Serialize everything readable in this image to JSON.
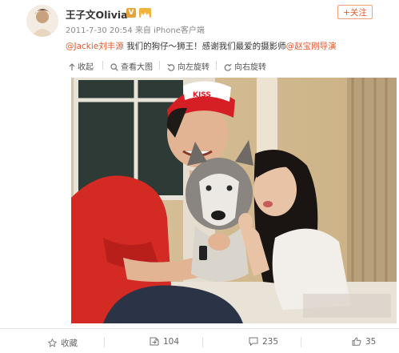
{
  "post": {
    "author": "王子文Olivia",
    "verified_badge": "V",
    "time": "2011-7-30 20:54",
    "source": "来自 iPhone客户端",
    "follow_label": "+关注",
    "caption": {
      "mention1": "@Jackie刘丰源",
      "text1": " 我们的狗仔～狮王！感谢我们最爱的摄影师",
      "mention2": "@赵宝刚导演"
    }
  },
  "toolbar": {
    "collapse": "收起",
    "view_large": "查看大图",
    "rotate_left": "向左旋转",
    "rotate_right": "向右旋转"
  },
  "actions": {
    "favorite": "收藏",
    "repost_count": "104",
    "comment_count": "235",
    "like_count": "35"
  },
  "colors": {
    "accent": "#e3592b",
    "text": "#333333",
    "muted": "#8a8a8a"
  },
  "icons": [
    "up-arrow-icon",
    "search-icon",
    "rotate-left-icon",
    "rotate-right-icon",
    "star-icon",
    "repost-icon",
    "comment-icon",
    "thumbs-up-icon"
  ]
}
